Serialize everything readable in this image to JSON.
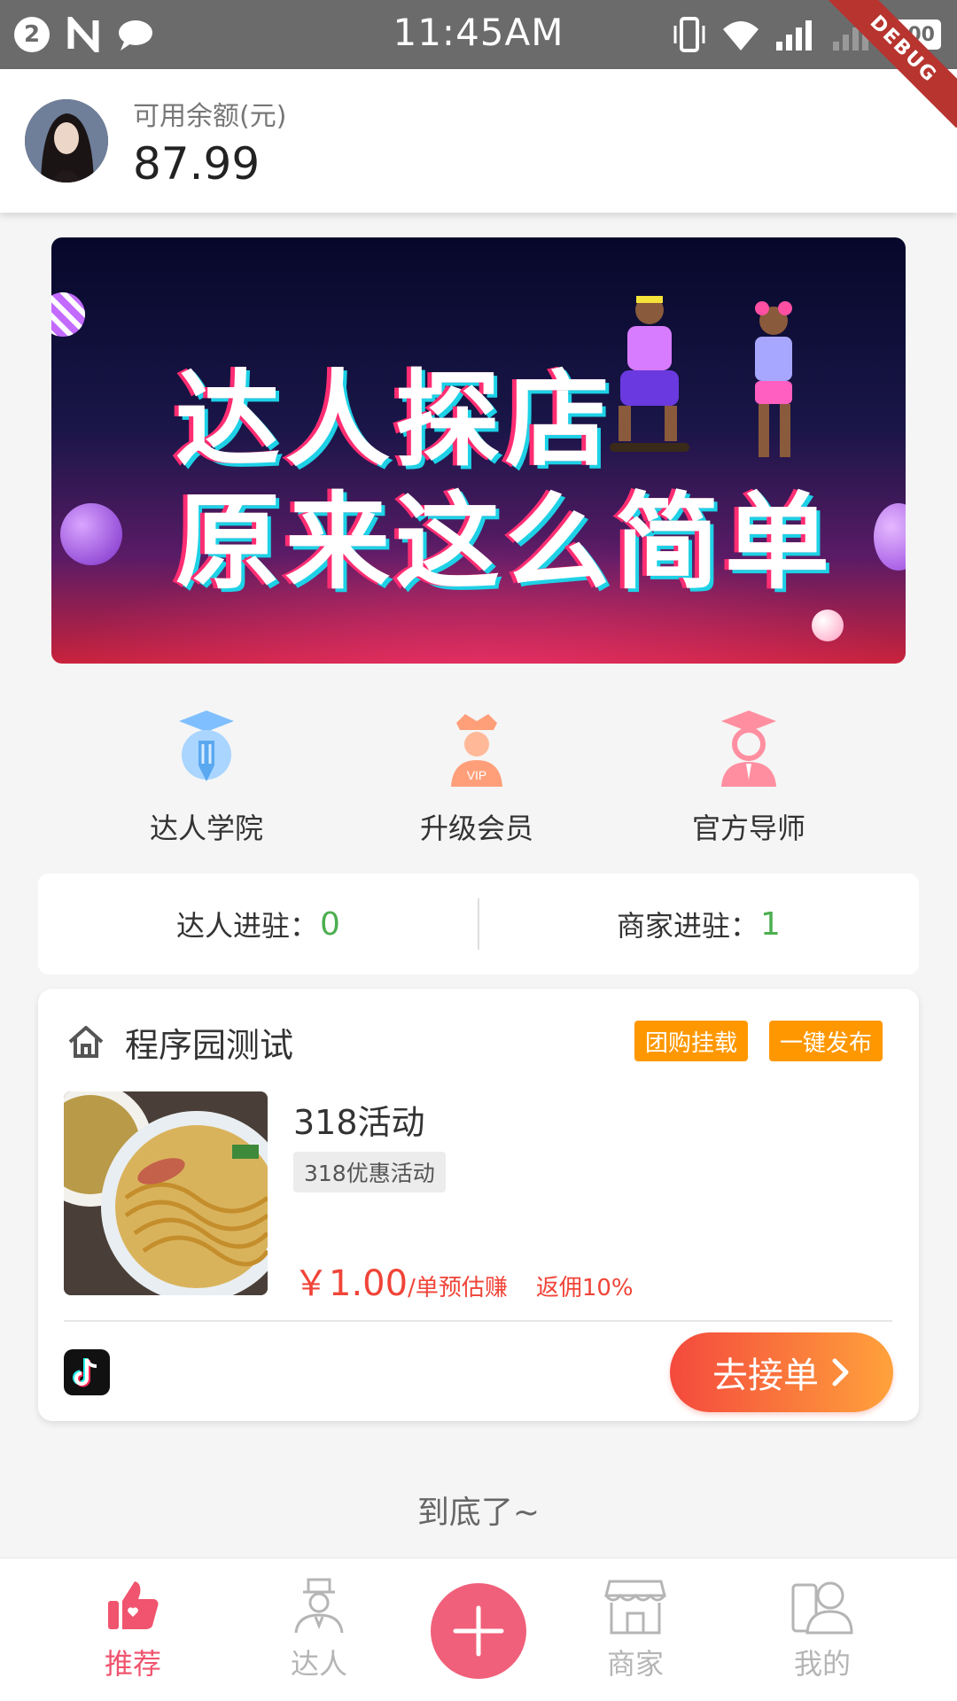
{
  "status_bar": {
    "notification_count": "2",
    "time": "11:45AM",
    "battery": "100",
    "icons": [
      "n-icon",
      "chat-icon",
      "vibrate-icon",
      "wifi-icon",
      "signal-icon",
      "signal-icon",
      "battery-icon"
    ]
  },
  "debug_banner": "DEBUG",
  "header": {
    "balance_label": "可用余额(元)",
    "balance_value": "87.99"
  },
  "banner": {
    "line1": "达人探店",
    "line2": "原来这么简单"
  },
  "entries": [
    {
      "label": "达人学院",
      "icon": "academy-icon",
      "color": "#7fbfff"
    },
    {
      "label": "升级会员",
      "icon": "vip-crown-icon",
      "color": "#ff9f7a"
    },
    {
      "label": "官方导师",
      "icon": "tutor-icon",
      "color": "#ff8fa0"
    }
  ],
  "stats": {
    "talent_label": "达人进驻：",
    "talent_count": "0",
    "merchant_label": "商家进驻：",
    "merchant_count": "1",
    "count_color": "#4caf50"
  },
  "card": {
    "shop_name": "程序园测试",
    "buttons": [
      "团购挂载",
      "一键发布"
    ],
    "activity_title": "318活动",
    "activity_tag": "318优惠活动",
    "price": "￥1.00",
    "price_unit": "/单预估赚",
    "rebate": "返佣10%",
    "action_label": "去接单",
    "platform_icon": "tiktok-icon",
    "accent": "#ff9800",
    "price_color": "#f04438"
  },
  "footer_text": "到底了~",
  "bottom_nav": {
    "items": [
      {
        "label": "推荐",
        "icon": "thumbs-up-icon",
        "active": true
      },
      {
        "label": "达人",
        "icon": "talent-icon",
        "active": false
      },
      {
        "label": "",
        "icon": "plus-icon",
        "active": false
      },
      {
        "label": "商家",
        "icon": "store-icon",
        "active": false
      },
      {
        "label": "我的",
        "icon": "profile-icon",
        "active": false
      }
    ],
    "active_color": "#f0546e"
  }
}
